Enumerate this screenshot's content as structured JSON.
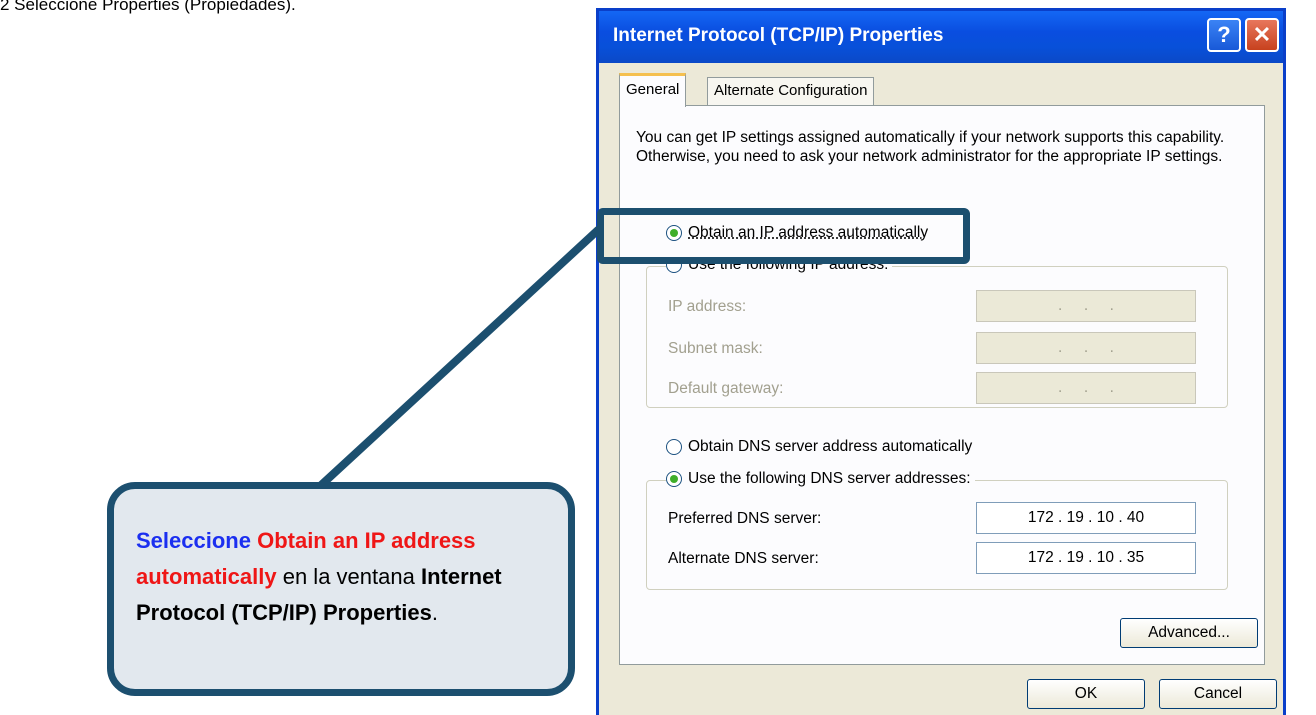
{
  "top_fragment": "2 Seleccione Properties (Propiedades).",
  "dialog": {
    "title": "Internet Protocol (TCP/IP) Properties",
    "help_glyph": "?",
    "close_glyph": "✕",
    "tabs": {
      "general": "General",
      "alternate": "Alternate Configuration"
    },
    "intro": "You can get IP settings assigned automatically if your network supports this capability. Otherwise, you need to ask your network administrator for the appropriate IP settings.",
    "ip_auto_label": "Obtain an IP address automatically",
    "ip_manual_label": "Use the following IP address:",
    "ip_fields": {
      "ip_label": "IP address:",
      "subnet_label": "Subnet mask:",
      "gateway_label": "Default gateway:",
      "empty_value": ".     .     ."
    },
    "dns_auto_label": "Obtain DNS server address automatically",
    "dns_manual_label": "Use the following DNS server addresses:",
    "dns_fields": {
      "preferred_label": "Preferred DNS server:",
      "preferred_value": "172 . 19 . 10 . 40",
      "alternate_label": "Alternate DNS server:",
      "alternate_value": "172 . 19 . 10 . 35"
    },
    "advanced_button": "Advanced...",
    "ok_button": "OK",
    "cancel_button": "Cancel"
  },
  "callout": {
    "part1": "Seleccione ",
    "part2": "Obtain an IP address automatically",
    "part3": " en la ventana ",
    "part4": "Internet Protocol (TCP/IP) Properties",
    "part5": "."
  }
}
